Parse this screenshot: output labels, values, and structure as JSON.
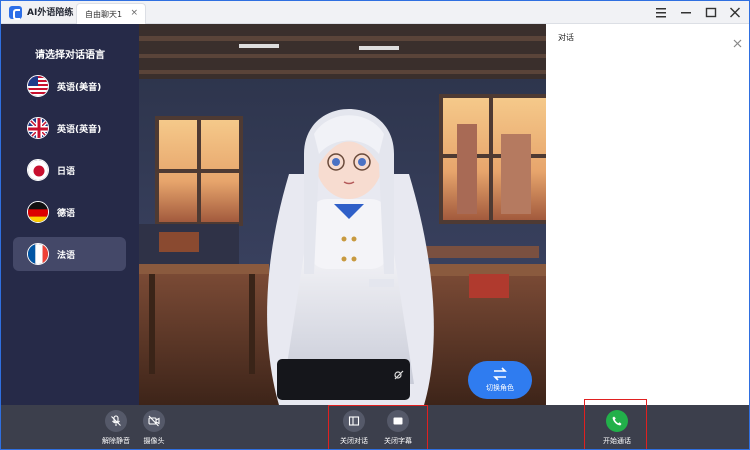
{
  "titlebar": {
    "app_title": "AI外语陪练",
    "tab_label": "自由聊天1",
    "tab_close": "×"
  },
  "sidebar": {
    "title": "请选择对话语言",
    "languages": [
      {
        "label": "英语(美音)",
        "flag": "us-flag-icon"
      },
      {
        "label": "英语(英音)",
        "flag": "uk-flag-icon"
      },
      {
        "label": "日语",
        "flag": "japan-flag-icon"
      },
      {
        "label": "德语",
        "flag": "germany-flag-icon"
      },
      {
        "label": "法语",
        "flag": "france-flag-icon",
        "selected": true
      }
    ]
  },
  "scene": {
    "switch_role_label": "切换角色"
  },
  "dialog": {
    "title": "对话"
  },
  "bottom": {
    "unmute_label": "解除静音",
    "camera_label": "摄像头",
    "close_dialog_label": "关闭对话",
    "close_subtitle_label": "关闭字幕",
    "start_call_label": "开始通话"
  },
  "colors": {
    "sidebar_bg": "#262a48",
    "accent_blue": "#2f7cf0",
    "call_green": "#22b04a",
    "highlight_red": "#e02020"
  }
}
